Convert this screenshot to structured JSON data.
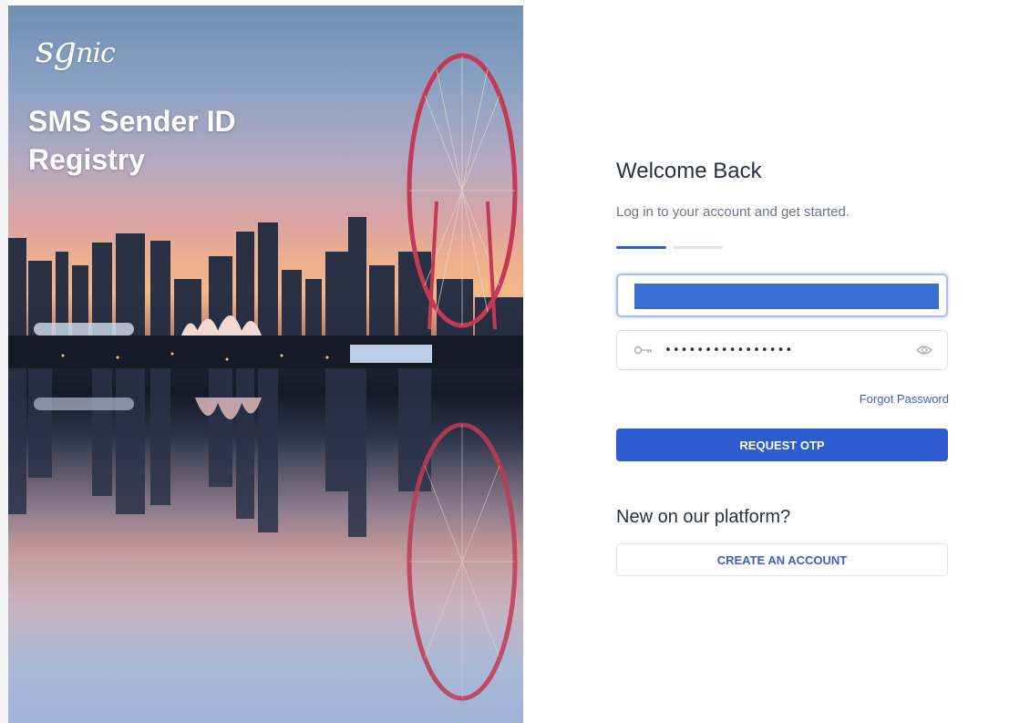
{
  "brand": {
    "logo_text_large": "sg",
    "logo_text_small": "nic",
    "title_line1": "SMS Sender ID",
    "title_line2": "Registry"
  },
  "login": {
    "heading": "Welcome Back",
    "subtitle": "Log in to your account and get started.",
    "steps_total": 2,
    "step_active": 1,
    "password_value": "••••••••••••••••",
    "forgot_password": "Forgot Password",
    "request_otp": "REQUEST OTP"
  },
  "signup": {
    "prompt": "New on our platform?",
    "create_account": "CREATE AN ACCOUNT"
  },
  "icons": {
    "password_leading": "key-icon",
    "password_toggle": "eye-icon"
  },
  "colors": {
    "accent": "#2d5bd0",
    "link": "#3b5fc6",
    "heading": "#2a2f45",
    "muted": "#6f7488"
  }
}
